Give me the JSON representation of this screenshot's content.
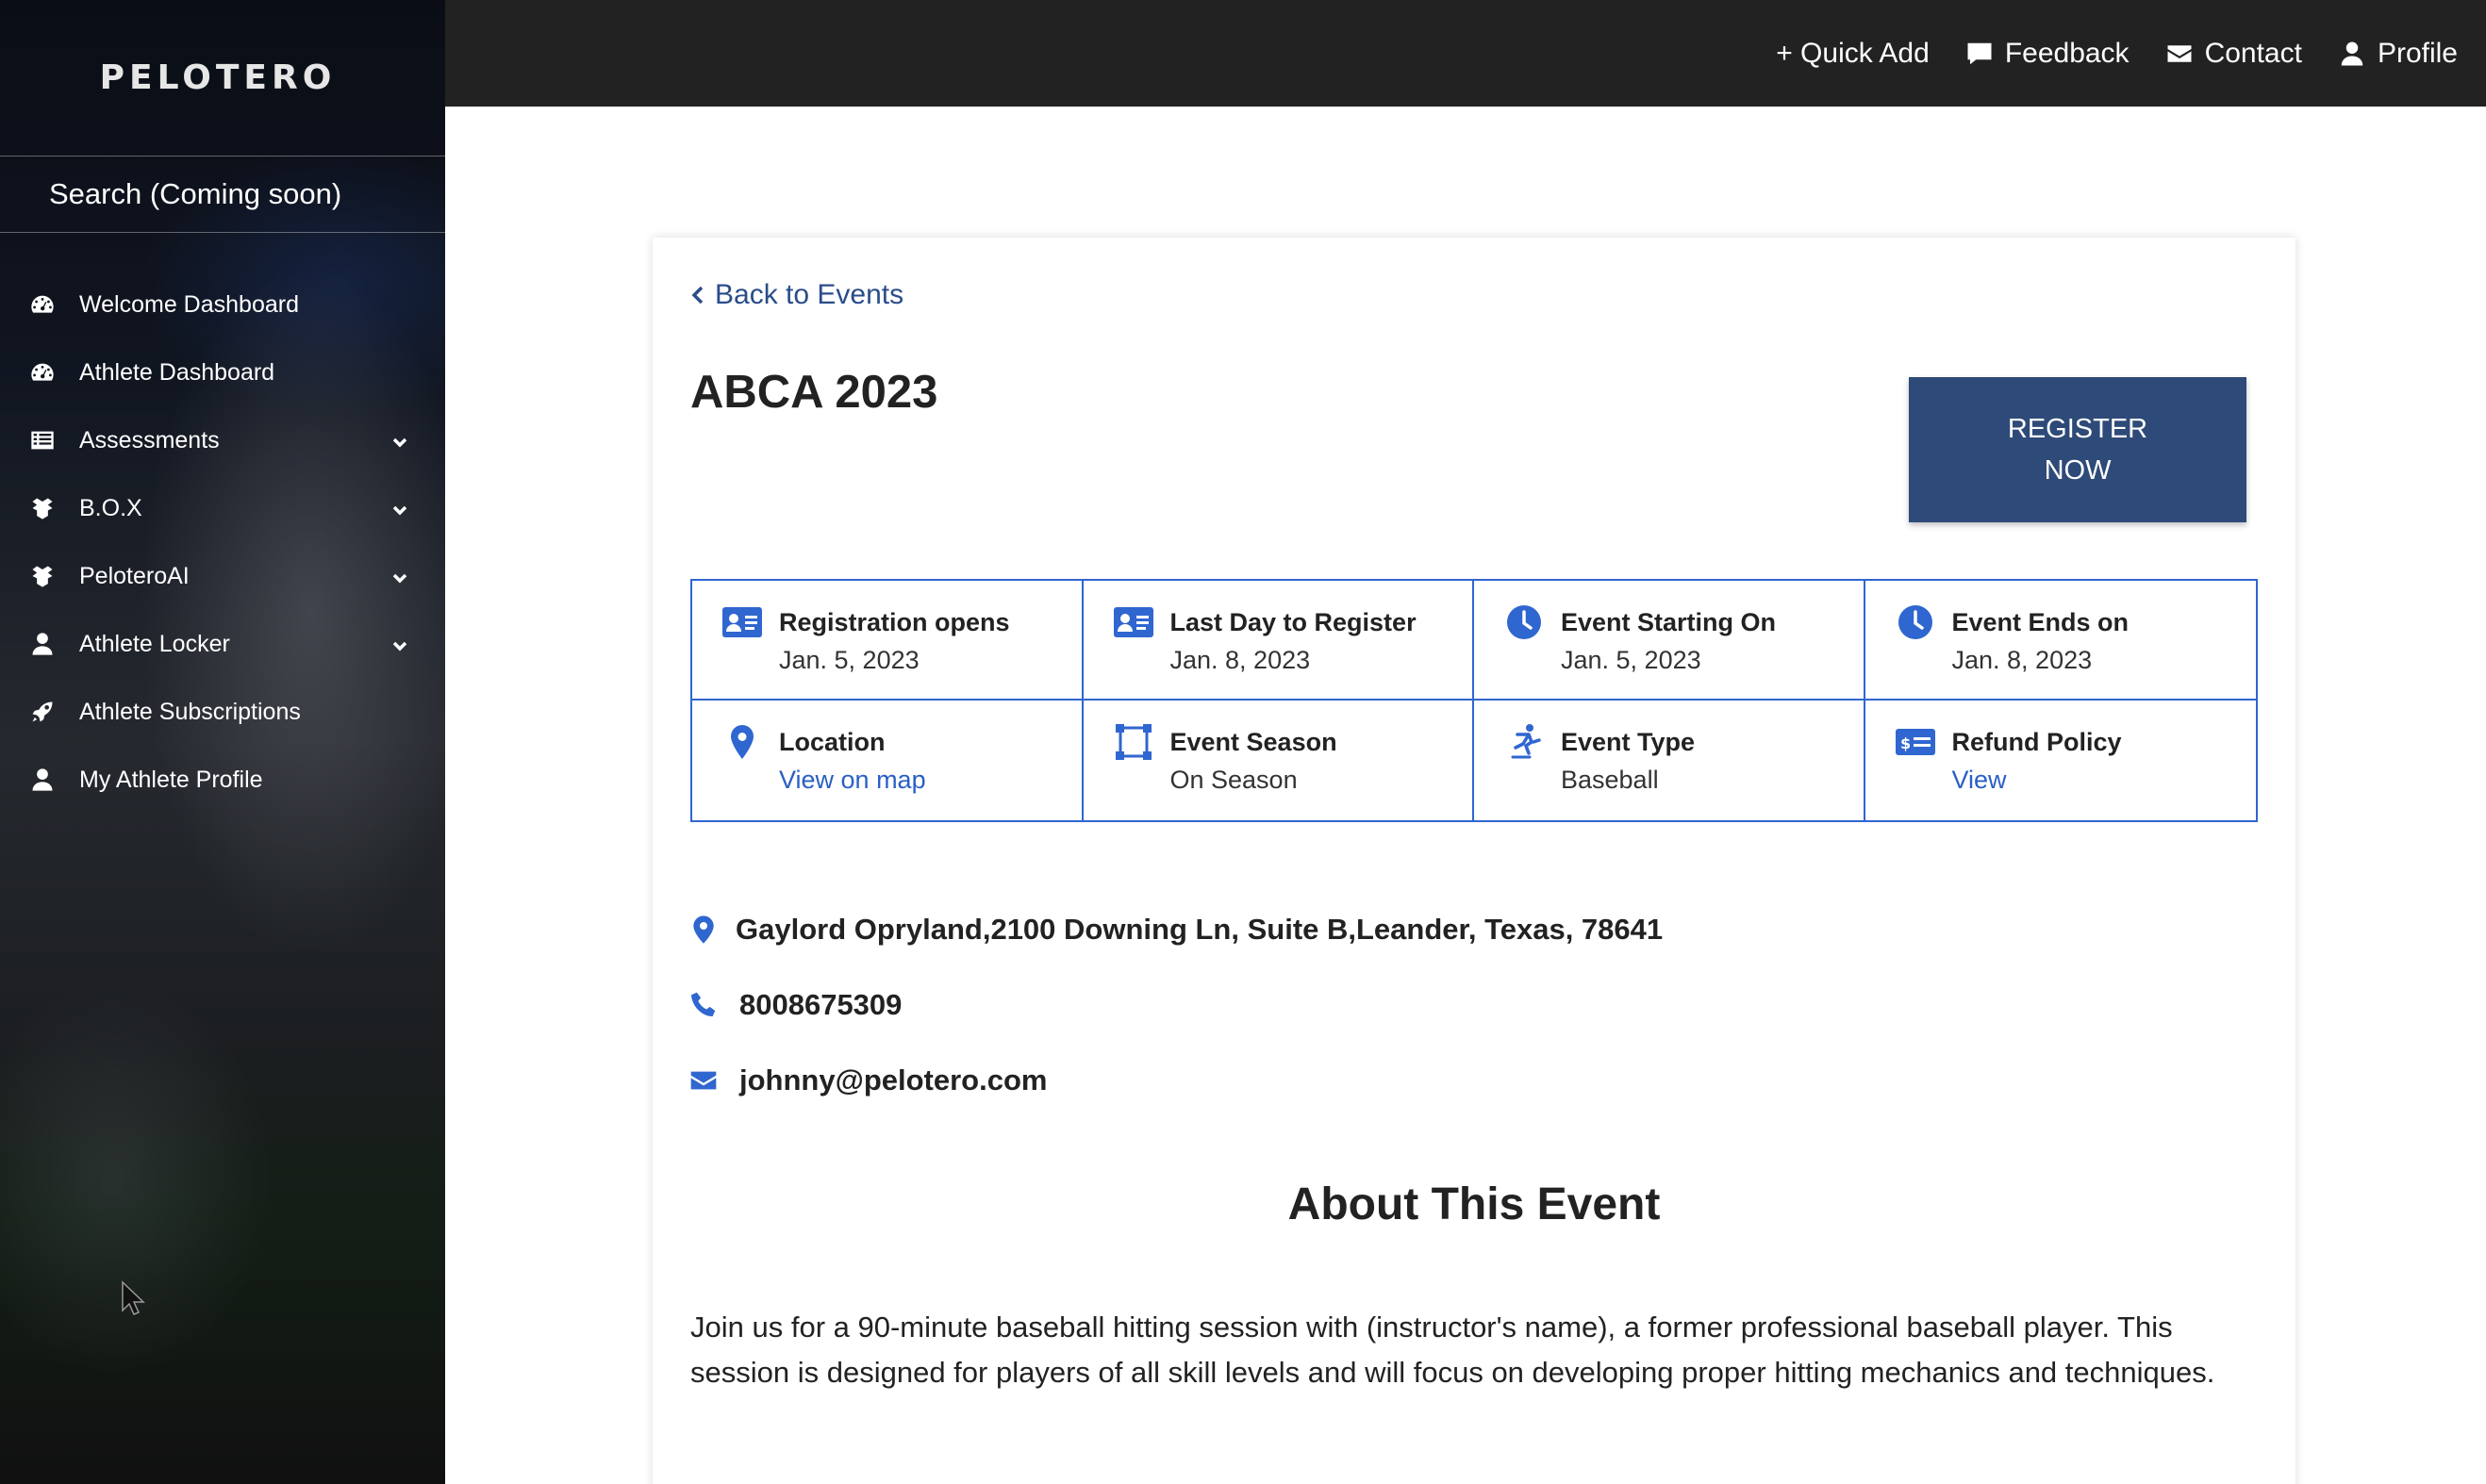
{
  "sidebar": {
    "logo": "PELOTERO",
    "search": "Search (Coming soon)",
    "items": [
      {
        "label": "Welcome Dashboard",
        "icon": "dashboard-icon"
      },
      {
        "label": "Athlete Dashboard",
        "icon": "dashboard-icon"
      },
      {
        "label": "Assessments",
        "icon": "list-icon",
        "expandable": true
      },
      {
        "label": "B.O.X",
        "icon": "box-icon",
        "expandable": true
      },
      {
        "label": "PeloteroAI",
        "icon": "box-icon",
        "expandable": true
      },
      {
        "label": "Athlete Locker",
        "icon": "user-icon",
        "expandable": true
      },
      {
        "label": "Athlete Subscriptions",
        "icon": "rocket-icon"
      },
      {
        "label": "My Athlete Profile",
        "icon": "user-icon"
      }
    ]
  },
  "topbar": {
    "quick_add": "+ Quick Add",
    "feedback": "Feedback",
    "contact": "Contact",
    "profile": "Profile"
  },
  "event": {
    "back": "Back to Events",
    "title": "ABCA 2023",
    "register": "REGISTER NOW",
    "details": [
      {
        "label": "Registration opens",
        "value": "Jan. 5, 2023",
        "icon": "id-card-icon"
      },
      {
        "label": "Last Day to Register",
        "value": "Jan. 8, 2023",
        "icon": "id-card-icon"
      },
      {
        "label": "Event Starting On",
        "value": "Jan. 5, 2023",
        "icon": "clock-icon"
      },
      {
        "label": "Event Ends on",
        "value": "Jan. 8, 2023",
        "icon": "clock-icon"
      },
      {
        "label": "Location",
        "value": "View on map",
        "icon": "map-pin-icon",
        "link": true
      },
      {
        "label": "Event Season",
        "value": "On Season",
        "icon": "frame-icon"
      },
      {
        "label": "Event Type",
        "value": "Baseball",
        "icon": "skater-icon"
      },
      {
        "label": "Refund Policy",
        "value": "View",
        "icon": "money-card-icon",
        "link": true
      }
    ],
    "address": "Gaylord Opryland,2100 Downing Ln, Suite B,Leander, Texas, 78641",
    "phone": "8008675309",
    "email": "johnny@pelotero.com",
    "about_title": "About This Event",
    "about_text": "Join us for a 90-minute baseball hitting session with (instructor's name), a former professional baseball player. This session is designed for players of all skill levels and will focus on developing proper hitting mechanics and techniques."
  },
  "colors": {
    "accent_blue": "#2f66d0",
    "button_navy": "#2e4a78",
    "topbar": "#222222"
  }
}
